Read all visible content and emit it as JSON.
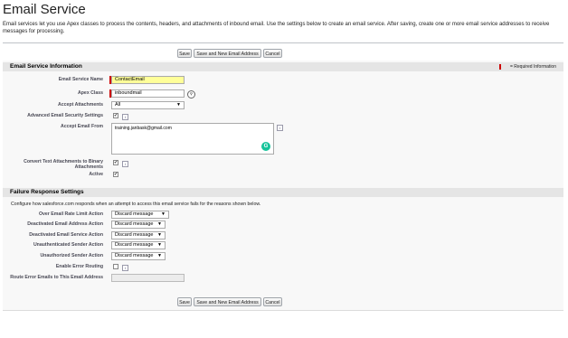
{
  "page": {
    "title": "Email Service",
    "intro": "Email services let you use Apex classes to process the contents, headers, and attachments of inbound email. Use the settings below to create an email service. After saving, create one or more email service addresses to receive messages for processing."
  },
  "buttons": {
    "save": "Save",
    "save_new": "Save and New Email Address",
    "cancel": "Cancel"
  },
  "info_section": {
    "heading": "Email Service Information",
    "required_legend": "= Required Information",
    "service_name_label": "Email Service Name",
    "service_name_value": "ContactEmail",
    "apex_class_label": "Apex Class",
    "apex_class_value": "inboundmail",
    "accept_attachments_label": "Accept Attachments",
    "accept_attachments_value": "All",
    "advanced_security_label": "Advanced Email Security Settings",
    "accept_from_label": "Accept Email From",
    "accept_from_value": "training.janbask@gmail.com",
    "convert_label": "Convert Text Attachments to Binary Attachments",
    "active_label": "Active",
    "check_mark": "✔",
    "info_glyph": "i",
    "grammarly_glyph": "G"
  },
  "failure_section": {
    "heading": "Failure Response Settings",
    "description": "Configure how salesforce.com responds when an attempt to access this email service fails for the reasons shown below.",
    "rows": [
      {
        "label": "Over Email Rate Limit Action",
        "value": "Discard message"
      },
      {
        "label": "Deactivated Email Address Action",
        "value": "Discard message"
      },
      {
        "label": "Deactivated Email Service Action",
        "value": "Discard message"
      },
      {
        "label": "Unauthenticated Sender Action",
        "value": "Discard message"
      },
      {
        "label": "Unauthorized Sender Action",
        "value": "Discard message"
      }
    ],
    "enable_routing_label": "Enable Error Routing",
    "route_to_label": "Route Error Emails to This Email Address"
  }
}
